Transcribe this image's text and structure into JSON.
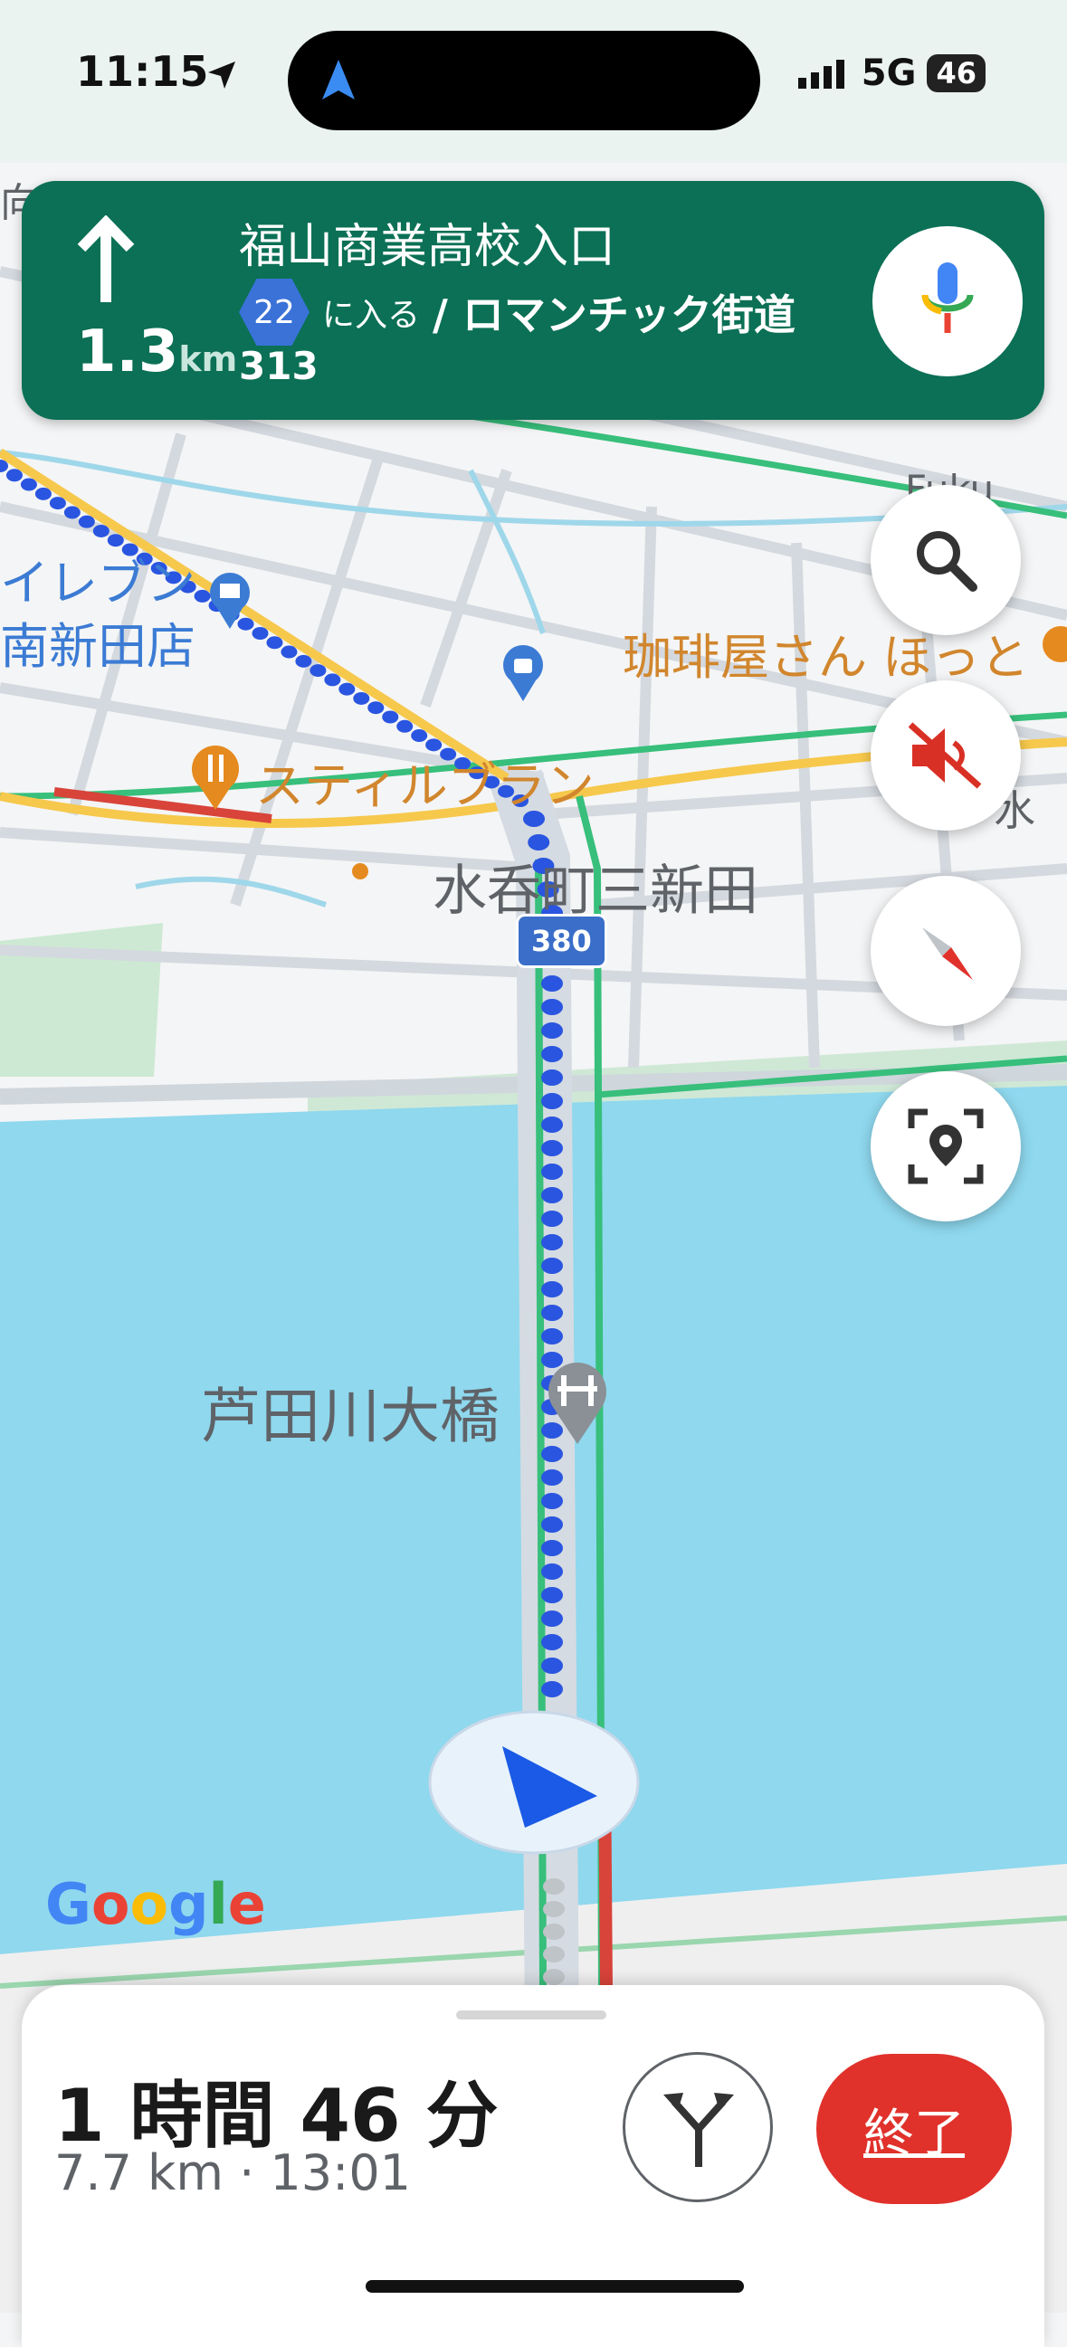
{
  "status": {
    "time": "11:15",
    "network": "5G",
    "battery": "46"
  },
  "banner": {
    "distance_value": "1.3",
    "distance_unit": "km",
    "street": "福山商業高校入口",
    "route_shield": "22",
    "enter_text": "に入る",
    "road_name": "/ ロマンチック街道",
    "route_number": "313",
    "icons": {
      "direction": "arrow-up-icon",
      "voice": "microphone-icon"
    }
  },
  "map": {
    "labels": {
      "seven_eleven_1": "イレブン",
      "seven_eleven_2": "南新田店",
      "coffee": "珈琲屋さん ほっと",
      "restaurant": "スティルブラン",
      "district": "水呑町三新田",
      "bridge": "芦田川大橋",
      "top_left_fragment": "向",
      "top_right_fragment": "水",
      "right_fragment_1": "Fuku",
      "right_fragment_2": "水"
    },
    "route_badge": "380",
    "google_logo": "Google"
  },
  "side_buttons": {
    "search": "search-icon",
    "sound": "mute-icon",
    "compass": "compass-icon",
    "report": "report-location-icon"
  },
  "bottom_sheet": {
    "eta_duration": "1 時間 46 分",
    "distance_time": "7.7 km · 13:01",
    "end_label": "終了",
    "route_options_icon": "route-options-icon"
  },
  "colors": {
    "banner": "#0b7055",
    "water": "#8fd8ee",
    "route": "#2a55e0",
    "end_button": "#e0312b"
  }
}
